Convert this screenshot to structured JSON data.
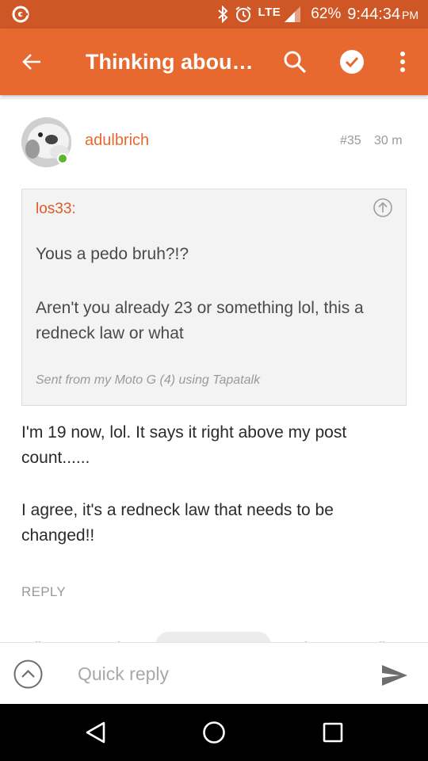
{
  "status_bar": {
    "network": "LTE",
    "battery": "62%",
    "time": "9:44:34",
    "ampm": "PM"
  },
  "app_bar": {
    "title": "Thinking abou…"
  },
  "post": {
    "author": "adulbrich",
    "number": "#35",
    "time_ago": "30 m",
    "quote": {
      "author": "los33:",
      "paragraph_1": "Yous a pedo bruh?!?",
      "paragraph_2": "Aren't you already 23 or something lol, this a redneck law or what",
      "signature": "Sent from my Moto G (4) using Tapatalk"
    },
    "body_1": "I'm 19 now, lol. It says it right above my post count......",
    "body_2": "I agree, it's a redneck law that needs to be changed!!",
    "reply_label": "REPLY"
  },
  "quick_reply": {
    "placeholder": "Quick reply"
  },
  "colors": {
    "status_bar": "#cf5726",
    "app_bar": "#e8692f",
    "accent": "#e8692f",
    "online": "#5cb52e"
  }
}
